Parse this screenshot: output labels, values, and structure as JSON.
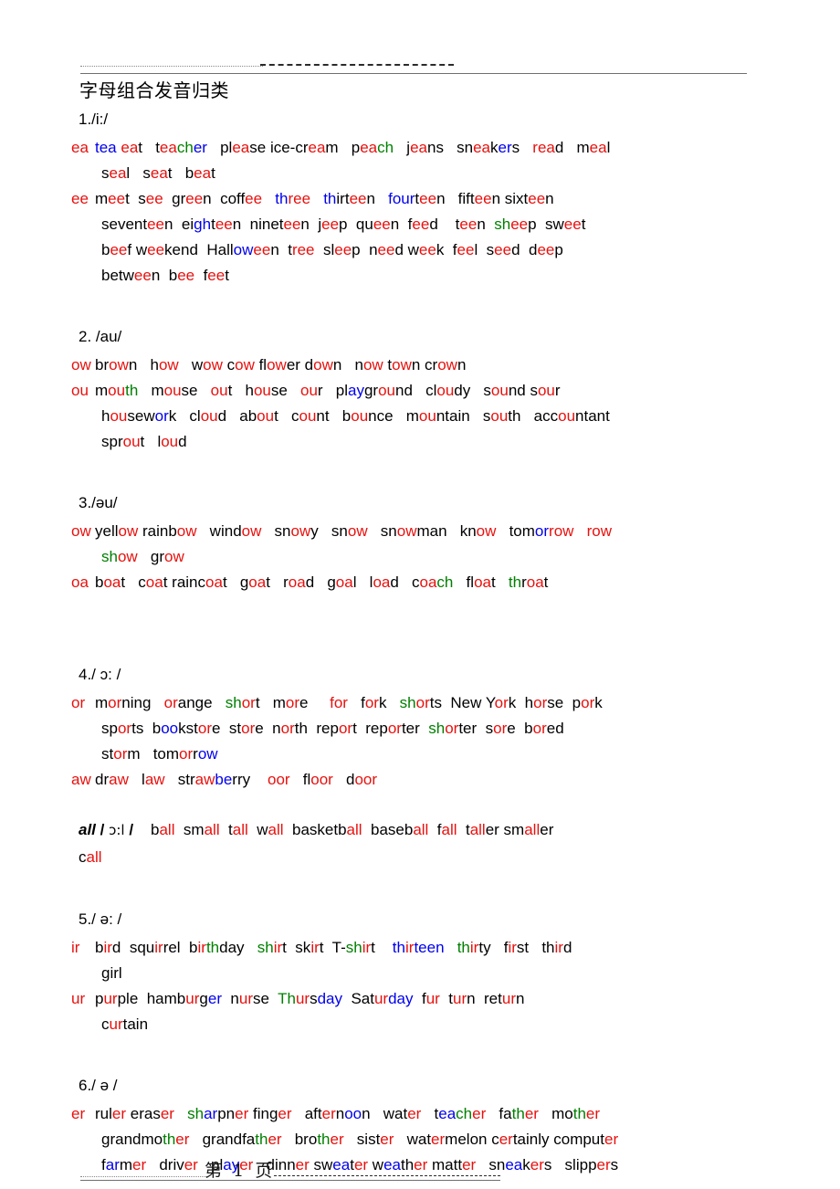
{
  "header": {
    "dash_left": "------------------------",
    "dash_right": "----------------------------------------"
  },
  "document": {
    "title": "字母组合发音归类"
  },
  "sections": [
    {
      "heading": "1./i:/",
      "groups": [
        {
          "key": "ea",
          "lines": [
            {
              "indent": false,
              "words": "ea   tea eat   teacher   please ice-cream   peach   jeans   sneakers   read   meal"
            },
            {
              "indent": true,
              "words": "seal   seat   beat"
            }
          ]
        },
        {
          "key": "ee",
          "lines": [
            {
              "indent": false,
              "words": "ee   meet  see  green  coffee   three   thirteen   fourteen   fifteen sixteen"
            },
            {
              "indent": true,
              "words": "seventeen  eighteen  nineteen  jeep  queen  feed    teen  sheep  sweet"
            },
            {
              "indent": true,
              "words": "beef weekend  Halloween  tree  sleep  need week  feel  seed  deep"
            },
            {
              "indent": true,
              "words": "between  bee  feet"
            }
          ]
        }
      ]
    },
    {
      "heading": "2. /au/",
      "groups": [
        {
          "key": "ow",
          "lines": [
            {
              "indent": false,
              "words": "ow brown   how   wow cow flower down   now town crown"
            }
          ]
        },
        {
          "key": "ou",
          "lines": [
            {
              "indent": false,
              "words": "ou mouth   mouse   out   house   our   playground   cloudy   sound sour"
            },
            {
              "indent": true,
              "words": "housework   cloud   about   count   bounce   mountain   south   accountant"
            },
            {
              "indent": true,
              "words": "sprout   loud"
            }
          ]
        }
      ]
    },
    {
      "heading": "3./əu/",
      "groups": [
        {
          "key": "ow",
          "lines": [
            {
              "indent": false,
              "words": "ow yellow rainbow   window   snowy   snow   snowman   know   tomorrow   row"
            },
            {
              "indent": true,
              "words": "show   grow"
            }
          ]
        },
        {
          "key": "oa",
          "lines": [
            {
              "indent": false,
              "words": "oa   boat   coat raincoat   goat   road   goal   load   coach   float   throat"
            }
          ]
        }
      ]
    },
    {
      "heading": "4./ ɔ: /",
      "groups": [
        {
          "key": "or",
          "lines": [
            {
              "indent": false,
              "words": "or   morning   orange   short   more     for   fork   shorts  New York  horse  pork"
            },
            {
              "indent": true,
              "words": "sports  bookstore  store  north  report  reporter  shorter  sore  bored"
            },
            {
              "indent": true,
              "words": "storm  tomorrow"
            }
          ]
        },
        {
          "key": "aw",
          "lines": [
            {
              "indent": false,
              "words": "aw   draw   law   strawberry    oor   floor   door"
            }
          ]
        }
      ],
      "all_row": {
        "word": "all",
        "slash_open": "/",
        "ipa": " ɔ:l ",
        "slash_close": "/",
        "words": "ball  small  tall  wall  basketball  baseball  fall  taller smaller",
        "wrap": "call"
      }
    },
    {
      "heading": "5./ ə: /",
      "groups": [
        {
          "key": "ir",
          "lines": [
            {
              "indent": false,
              "words": "ir  bird  squirrel  birthday   shirt  skirt  T-shirt    thirteen   thirty   first   third"
            },
            {
              "indent": true,
              "words": "girl"
            }
          ]
        },
        {
          "key": "ur",
          "lines": [
            {
              "indent": false,
              "words": "ur  purple  hamburger  nurse  Thursday  Saturday  fur  turn  return"
            },
            {
              "indent": true,
              "words": "curtain"
            }
          ]
        }
      ]
    },
    {
      "heading": "6./ ə /",
      "groups": [
        {
          "key": "er",
          "lines": [
            {
              "indent": false,
              "words": "er  ruler eraser   sharpner finger   afternoon   water   teacher   father   mother"
            },
            {
              "indent": true,
              "words": "grandmother   grandfather   brother   sister   watermelon certainly computer"
            },
            {
              "indent": true,
              "words": "farmer   driver   player   dinner sweater weather matter   sneakers   slippers"
            }
          ]
        }
      ]
    }
  ],
  "footer": {
    "page_label": "第  1  页",
    "dash_left": "---------------",
    "dash_right": "--------------------------------"
  },
  "colors": {
    "highlight_red": "#e8110e",
    "highlight_green": "#008000",
    "highlight_blue": "#0000ee",
    "text": "#000000"
  }
}
